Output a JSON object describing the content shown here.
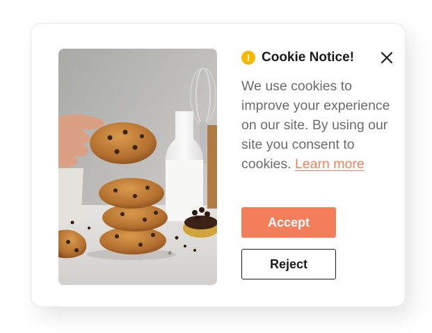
{
  "notice": {
    "title": "Cookie Notice!",
    "warning_glyph": "!",
    "warning_icon": "exclamation-circle-icon",
    "close_icon": "close-icon",
    "message": "We use cookies to improve your experience on our site. By using our site you consent to cookies.",
    "learn_more": "Learn more",
    "accept_label": "Accept",
    "reject_label": "Reject",
    "image": "cookies-stack-photo"
  },
  "colors": {
    "accent": "#f47e5a",
    "warning": "#f5b800",
    "text_primary": "#1a1a1a",
    "text_body": "#6b6b6b"
  }
}
